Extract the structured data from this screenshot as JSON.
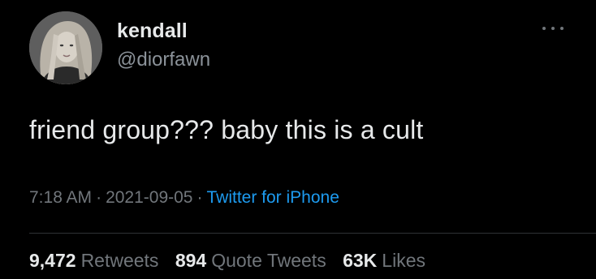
{
  "user": {
    "display_name": "kendall",
    "handle": "@diorfawn",
    "avatar_icon": "profile-photo"
  },
  "more_icon": "ellipsis-icon",
  "tweet": {
    "text": "friend group??? baby this is a cult"
  },
  "meta": {
    "time": "7:18 AM",
    "separator": "·",
    "date": "2021-09-05",
    "source": "Twitter for iPhone"
  },
  "stats": {
    "retweets_count": "9,472",
    "retweets_label": "Retweets",
    "quotes_count": "894",
    "quotes_label": "Quote Tweets",
    "likes_count": "63K",
    "likes_label": "Likes"
  },
  "colors": {
    "background": "#000000",
    "primary_text": "#e7e9ea",
    "secondary_text": "#71767b",
    "link": "#1d9bf0"
  }
}
